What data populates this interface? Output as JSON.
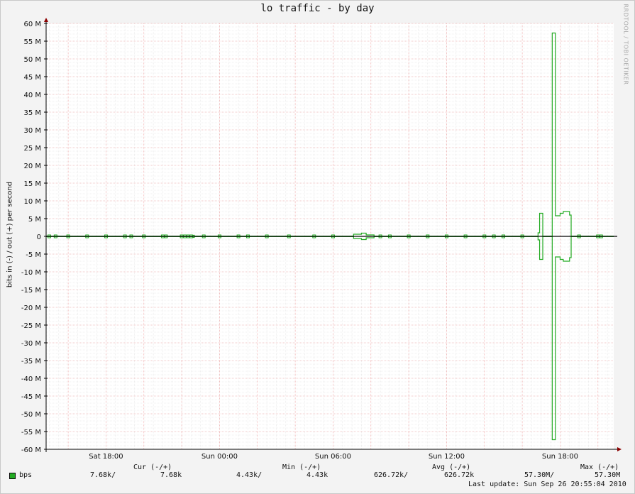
{
  "chart_data": {
    "type": "line",
    "title": "lo traffic - by day",
    "ylabel": "bits in (-) / out (+) per second",
    "watermark": "RRDTOOL / TOBI OETIKER",
    "ylim": [
      -60000000,
      60000000
    ],
    "y_ticks": [
      {
        "value": 60000000,
        "label": "60 M"
      },
      {
        "value": 55000000,
        "label": "55 M"
      },
      {
        "value": 50000000,
        "label": "50 M"
      },
      {
        "value": 45000000,
        "label": "45 M"
      },
      {
        "value": 40000000,
        "label": "40 M"
      },
      {
        "value": 35000000,
        "label": "35 M"
      },
      {
        "value": 30000000,
        "label": "30 M"
      },
      {
        "value": 25000000,
        "label": "25 M"
      },
      {
        "value": 20000000,
        "label": "20 M"
      },
      {
        "value": 15000000,
        "label": "15 M"
      },
      {
        "value": 10000000,
        "label": "10 M"
      },
      {
        "value": 5000000,
        "label": "5 M"
      },
      {
        "value": 0,
        "label": "0"
      },
      {
        "value": -5000000,
        "label": "-5 M"
      },
      {
        "value": -10000000,
        "label": "-10 M"
      },
      {
        "value": -15000000,
        "label": "-15 M"
      },
      {
        "value": -20000000,
        "label": "-20 M"
      },
      {
        "value": -25000000,
        "label": "-25 M"
      },
      {
        "value": -30000000,
        "label": "-30 M"
      },
      {
        "value": -35000000,
        "label": "-35 M"
      },
      {
        "value": -40000000,
        "label": "-40 M"
      },
      {
        "value": -45000000,
        "label": "-45 M"
      },
      {
        "value": -50000000,
        "label": "-50 M"
      },
      {
        "value": -55000000,
        "label": "-55 M"
      },
      {
        "value": -60000000,
        "label": "-60 M"
      }
    ],
    "xlim": [
      "Sat 14:50",
      "Sun 20:50"
    ],
    "x_ticks": [
      {
        "value": "Sat 18:00",
        "label": "Sat 18:00"
      },
      {
        "value": "Sun 00:00",
        "label": "Sun 00:00"
      },
      {
        "value": "Sun 06:00",
        "label": "Sun 06:00"
      },
      {
        "value": "Sun 12:00",
        "label": "Sun 12:00"
      },
      {
        "value": "Sun 18:00",
        "label": "Sun 18:00"
      }
    ],
    "grid": true,
    "colors": {
      "series": "#22aa22",
      "grid_minor": "#dddddd",
      "grid_major": "#f0a0a0",
      "axis": "#000000"
    },
    "series": [
      {
        "name": "bps",
        "note_direction": "out (+)",
        "points": [
          [
            "Sat 14:50",
            0.05
          ],
          [
            "Sat 22:30",
            0.05
          ],
          [
            "Sat 22:35",
            0.3
          ],
          [
            "Sat 22:40",
            0.05
          ],
          [
            "Sun 07:00",
            0.05
          ],
          [
            "Sun 07:05",
            0.6
          ],
          [
            "Sun 07:25",
            0.6
          ],
          [
            "Sun 07:30",
            0.9
          ],
          [
            "Sun 07:40",
            0.9
          ],
          [
            "Sun 07:45",
            0.4
          ],
          [
            "Sun 08:05",
            0.4
          ],
          [
            "Sun 08:10",
            0.05
          ],
          [
            "Sun 16:45",
            0.05
          ],
          [
            "Sun 16:50",
            1.0
          ],
          [
            "Sun 16:55",
            6.5
          ],
          [
            "Sun 17:00",
            6.5
          ],
          [
            "Sun 17:05",
            0.05
          ],
          [
            "Sun 17:30",
            0.05
          ],
          [
            "Sun 17:35",
            57.3
          ],
          [
            "Sun 17:40",
            57.3
          ],
          [
            "Sun 17:45",
            5.8
          ],
          [
            "Sun 17:55",
            5.8
          ],
          [
            "Sun 18:00",
            6.5
          ],
          [
            "Sun 18:10",
            7.0
          ],
          [
            "Sun 18:25",
            7.0
          ],
          [
            "Sun 18:30",
            6.0
          ],
          [
            "Sun 18:35",
            0.05
          ],
          [
            "Sun 20:50",
            0.05
          ]
        ],
        "unit": "Mbps"
      }
    ],
    "legend": {
      "headers": {
        "cur": "Cur (-/+)",
        "min": "Min (-/+)",
        "avg": "Avg (-/+)",
        "max": "Max (-/+)"
      },
      "rows": [
        {
          "name": "bps",
          "cur_in": "7.68k/",
          "cur_out": "7.68k",
          "min_in": "4.43k/",
          "min_out": "4.43k",
          "avg_in": "626.72k/",
          "avg_out": "626.72k",
          "max_in": "57.30M/",
          "max_out": "57.30M"
        }
      ]
    },
    "last_update": "Last update: Sun Sep 26 20:55:04 2010"
  }
}
